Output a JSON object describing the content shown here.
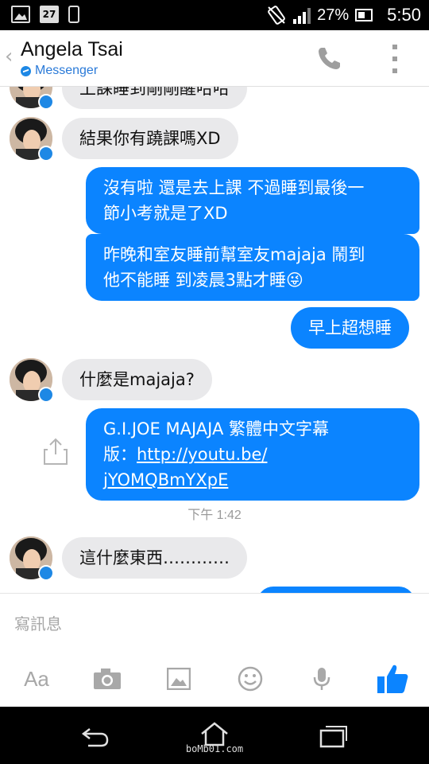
{
  "status_bar": {
    "calendar_day": "27",
    "battery": "27%",
    "time": "5:50",
    "icons": [
      "image-icon",
      "calendar-icon",
      "phone-icon",
      "vibrate-icon",
      "signal-icon",
      "battery-charging-icon"
    ]
  },
  "header": {
    "back_icon": "chevron-left-icon",
    "contact_name": "Angela Tsai",
    "subtitle": "Messenger",
    "call_icon": "phone-icon",
    "menu_icon": "more-vertical-icon"
  },
  "messages": [
    {
      "from": "them",
      "text": "上課睡到剛剛醒哈哈"
    },
    {
      "from": "them",
      "text": "結果你有蹺課嗎XD"
    },
    {
      "from": "me",
      "lines": [
        "沒有啦 還是去上課 不過睡到最後一",
        "節小考就是了XD"
      ]
    },
    {
      "from": "me",
      "lines": [
        "昨晚和室友睡前幫室友majaja 鬧到",
        "他不能睡 到凌晨3點才睡😜"
      ]
    },
    {
      "from": "me",
      "text": "早上超想睡"
    },
    {
      "from": "them",
      "text": "什麼是majaja?"
    },
    {
      "from": "me",
      "line1": "G.I.JOE MAJAJA 繁體中文字幕",
      "line2_prefix": "版：",
      "link_part1": "http://youtu.be/",
      "link_part2": "jYOMQBmYXpE"
    },
    {
      "from": "them",
      "text": "這什麼東西…………"
    }
  ],
  "timestamp": "下午 1:42",
  "composer": {
    "placeholder": "寫訊息",
    "tools": [
      "Aa",
      "camera-icon",
      "gallery-icon",
      "emoji-icon",
      "microphone-icon",
      "like-icon"
    ]
  },
  "colors": {
    "accent": "#0b84ff",
    "incoming_bubble": "#e9e9eb",
    "messenger_blue": "#1e88e5"
  },
  "watermark": "boMb01.com"
}
